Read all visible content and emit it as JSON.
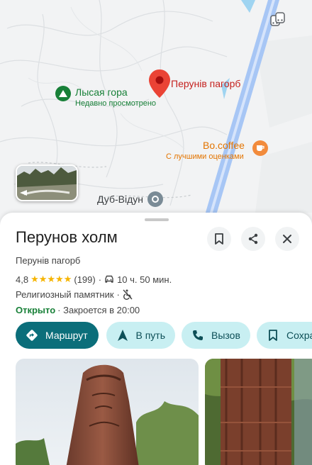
{
  "map": {
    "pin_label": "Перунів пагорб",
    "poi_lysaya": {
      "label": "Лысая гора",
      "sublabel": "Недавно просмотрено"
    },
    "poi_coffee": {
      "label": "Bo.coffee",
      "sublabel": "С лучшими оценками"
    },
    "poi_dub": {
      "label": "Дуб-Відун"
    },
    "colors": {
      "pin": "#ea4335",
      "park": "#188038",
      "coffee": "#f28b3c",
      "road": "#8ab4f8"
    }
  },
  "place": {
    "title": "Перунов холм",
    "subtitle": "Перунів пагорб",
    "rating": "4,8",
    "stars": "★★★★★",
    "reviews": "(199)",
    "separator": "·",
    "drive_time": "10 ч. 50 мин.",
    "category": "Религиозный памятник",
    "open_status": "Открыто",
    "closes": "· Закроется в 20:00"
  },
  "actions": {
    "route": "Маршрут",
    "go": "В путь",
    "call": "Вызов",
    "save": "Сохра"
  },
  "header_icons": [
    "bookmark-icon",
    "share-icon",
    "close-icon"
  ]
}
